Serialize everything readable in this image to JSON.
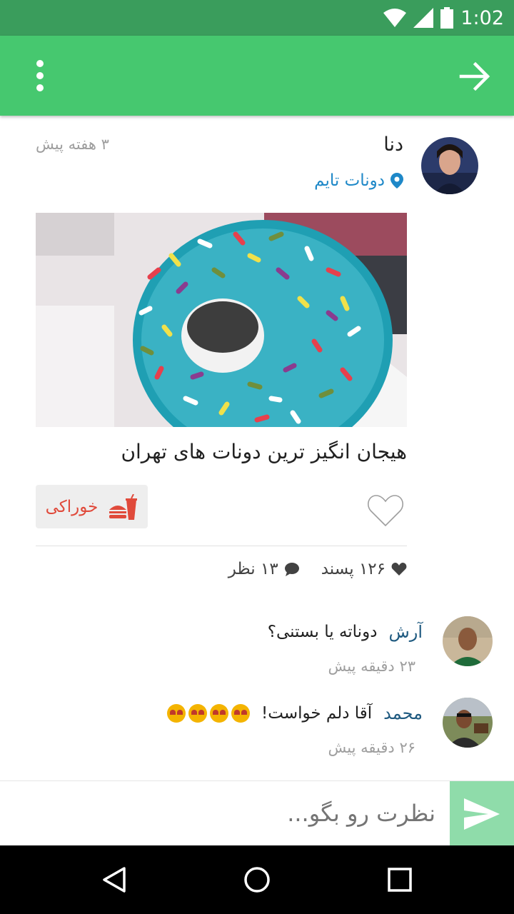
{
  "status_bar": {
    "time": "1:02"
  },
  "post": {
    "author": "دنا",
    "time": "۳ هفته پیش",
    "location": "دونات تایم",
    "title": "هیجان انگیز ترین دونات های تهران",
    "tag": "خوراکی",
    "likes": "۱۲۶ پسند",
    "comments_count": "۱۳ نظر"
  },
  "comments": [
    {
      "author": "آرش",
      "text": "دوناته یا بستنی؟",
      "time": "۲۳ دقیقه پیش"
    },
    {
      "author": "محمد",
      "text": "آقا دلم خواست!",
      "time": "۲۶ دقیقه پیش"
    }
  ],
  "comment_box": {
    "placeholder": "نظرت رو بگو..."
  },
  "colors": {
    "status_bar": "#3a9d5c",
    "toolbar": "#46c86f",
    "send_button": "#8fdcaa",
    "location": "#1e88c8",
    "tag_text": "#e04a3b",
    "comment_author": "#1f5a80"
  },
  "icons": {
    "toolbar": [
      "more-vert-icon",
      "arrow-forward-icon"
    ],
    "location": "location-pin-icon",
    "tag": "fast-food-icon",
    "like": "heart-outline-icon",
    "stats": [
      "heart-icon",
      "chat-bubble-icon"
    ],
    "comment_emoji": "heart-eyes-emoji-icon",
    "send": "send-icon",
    "nav": [
      "back-triangle-icon",
      "home-circle-icon",
      "recents-square-icon"
    ]
  }
}
